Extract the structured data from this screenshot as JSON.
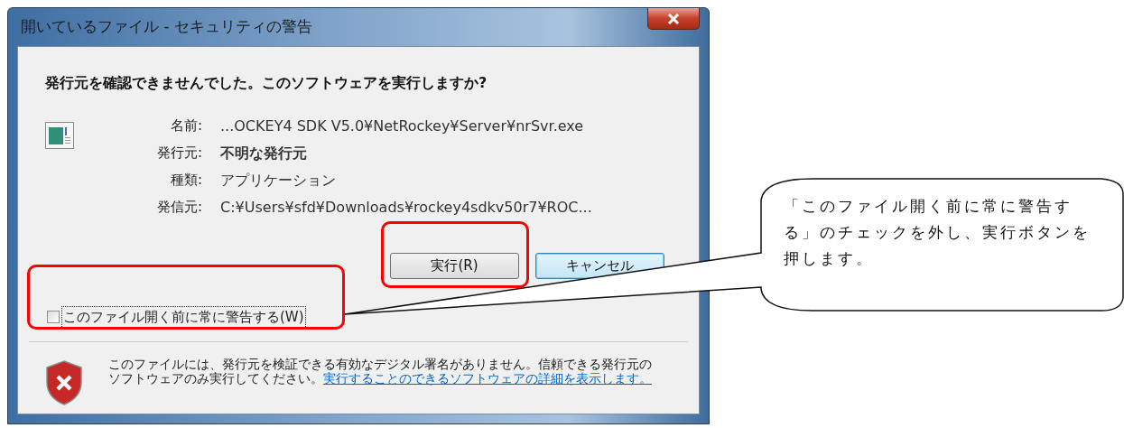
{
  "window": {
    "title": "開いているファイル - セキュリティの警告"
  },
  "heading": "発行元を確認できませんでした。このソフトウェアを実行しますか?",
  "details": [
    {
      "label": "名前:",
      "value": "...OCKEY4 SDK V5.0¥NetRockey¥Server¥nrSvr.exe",
      "bold": false
    },
    {
      "label": "発行元:",
      "value": "不明な発行元",
      "bold": true
    },
    {
      "label": "種類:",
      "value": "アプリケーション",
      "bold": false
    },
    {
      "label": "発信元:",
      "value": "C:¥Users¥sfd¥Downloads¥rockey4sdkv50r7¥ROC...",
      "bold": false
    }
  ],
  "buttons": [
    {
      "label": "実行(R)",
      "focused": false
    },
    {
      "label": "キャンセル",
      "focused": true
    }
  ],
  "checkbox": {
    "label": "このファイル開く前に常に警告する(W)",
    "checked": false
  },
  "footer": {
    "text": "このファイルには、発行元を検証できる有効なデジタル署名がありません。信頼できる発行元のソフトウェアのみ実行してください。",
    "link": "実行することのできるソフトウェアの詳細を表示します。"
  },
  "annotation": {
    "text": "「このファイル開く前に常に警告する」のチェックを外し、実行ボタンを押します。"
  }
}
